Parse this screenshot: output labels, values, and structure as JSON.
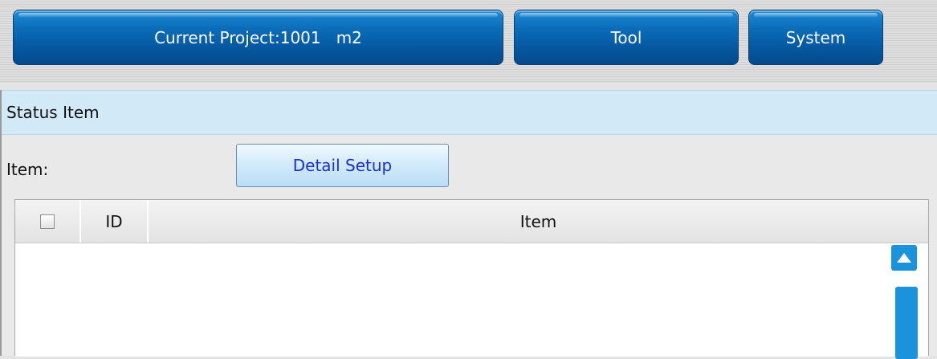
{
  "topbar": {
    "project_label": "Current Project:1001   m2",
    "tool_label": "Tool",
    "system_label": "System"
  },
  "panel": {
    "title": "Status Item",
    "item_label": "Item:",
    "detail_button": "Detail Setup"
  },
  "table": {
    "columns": [
      "",
      "ID",
      "Item"
    ],
    "rows": []
  },
  "icons": {
    "scroll_up": "triangle-up-icon",
    "checkbox": "checkbox-icon"
  },
  "colors": {
    "accent_blue": "#0a6cb8",
    "header_bg": "#d2eaf7",
    "link_text": "#1a2ed6",
    "scroll_blue": "#1a93dc"
  }
}
